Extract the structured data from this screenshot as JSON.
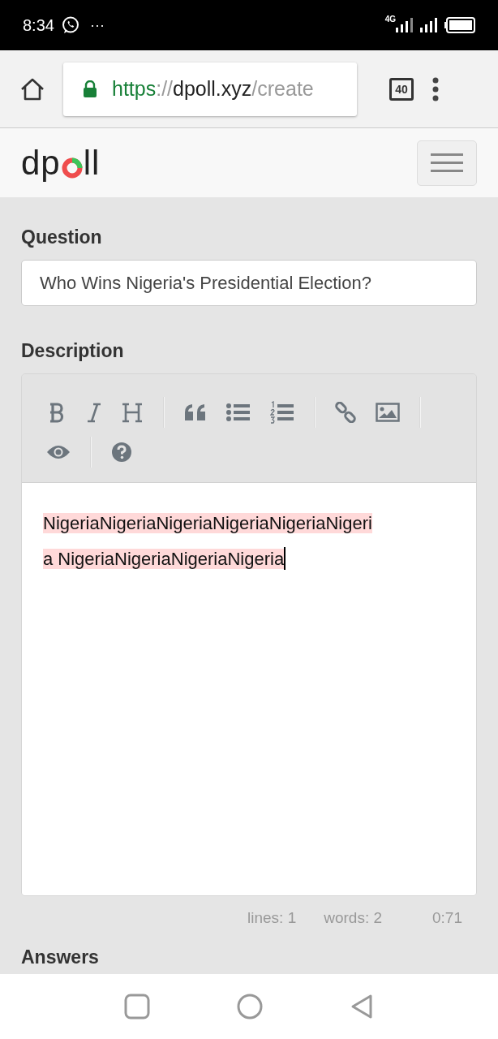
{
  "status_bar": {
    "time": "8:34",
    "notifications": "···",
    "network": "4G"
  },
  "browser": {
    "url_parts": [
      {
        "text": "https",
        "kind": "secure"
      },
      {
        "text": "://",
        "kind": "dim"
      },
      {
        "text": "dpoll.xyz",
        "kind": "host"
      },
      {
        "text": "/create",
        "kind": "dim"
      }
    ],
    "tab_count": "40"
  },
  "navbar": {
    "logo_before": "dp",
    "logo_after": "ll"
  },
  "form": {
    "question_label": "Question",
    "question_value": "Who Wins Nigeria's Presidential Election?",
    "description_label": "Description",
    "toolbar": [
      {
        "kind": "bold"
      },
      {
        "kind": "italic"
      },
      {
        "kind": "heading"
      },
      {
        "kind": "sep"
      },
      {
        "kind": "quote"
      },
      {
        "kind": "bullets"
      },
      {
        "kind": "numbers"
      },
      {
        "kind": "sep"
      },
      {
        "kind": "link"
      },
      {
        "kind": "image"
      },
      {
        "kind": "sep"
      },
      {
        "kind": "preview"
      },
      {
        "kind": "sep"
      },
      {
        "kind": "help"
      }
    ],
    "editor_lines": [
      "NigeriaNigeriaNigeriaNigeriaNigeriaNigeri",
      "a NigeriaNigeriaNigeriaNigeria"
    ],
    "stats": [
      "lines: 1",
      "words: 2"
    ],
    "cursor": "0:71",
    "answers_label": "Answers"
  }
}
